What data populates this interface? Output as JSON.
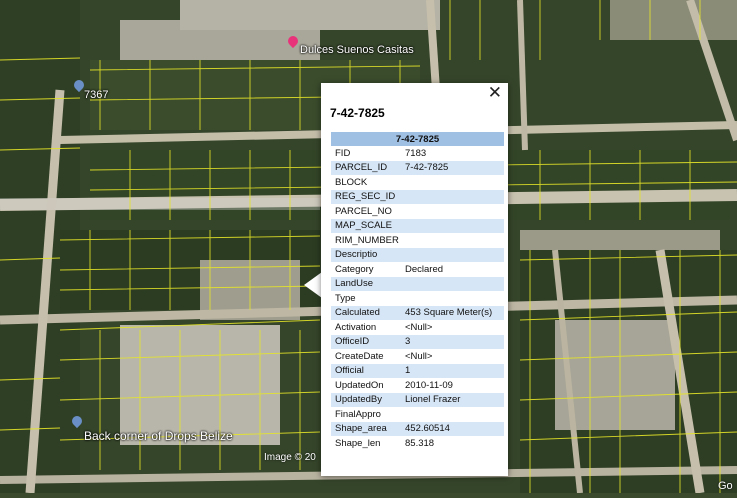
{
  "map": {
    "places": [
      {
        "name": "Dulces Suenos Casitas",
        "pin_color": "#e8337a"
      },
      {
        "name": "7367",
        "pin_color": "#6a8fc7"
      },
      {
        "name": "Back corner of Drops Belize",
        "pin_color": "#6a8fc7"
      }
    ],
    "credit_left": "Image © 20",
    "credit_right": "Go"
  },
  "popup": {
    "title": "7-42-7825",
    "close_glyph": "✕",
    "table_header": "7-42-7825",
    "rows": [
      {
        "key": "FID",
        "value": "7183"
      },
      {
        "key": "PARCEL_ID",
        "value": "7-42-7825"
      },
      {
        "key": "BLOCK",
        "value": ""
      },
      {
        "key": "REG_SEC_ID",
        "value": ""
      },
      {
        "key": "PARCEL_NO",
        "value": ""
      },
      {
        "key": "MAP_SCALE",
        "value": ""
      },
      {
        "key": "RIM_NUMBER",
        "value": ""
      },
      {
        "key": "Descriptio",
        "value": ""
      },
      {
        "key": "Category",
        "value": "Declared"
      },
      {
        "key": "LandUse",
        "value": ""
      },
      {
        "key": "Type",
        "value": ""
      },
      {
        "key": "Calculated",
        "value": "453 Square Meter(s)"
      },
      {
        "key": "Activation",
        "value": "<Null>"
      },
      {
        "key": "OfficeID",
        "value": "3"
      },
      {
        "key": "CreateDate",
        "value": "<Null>"
      },
      {
        "key": "Official",
        "value": "1"
      },
      {
        "key": "UpdatedOn",
        "value": "2010-11-09"
      },
      {
        "key": "UpdatedBy",
        "value": "Lionel Frazer"
      },
      {
        "key": "FinalAppro",
        "value": ""
      },
      {
        "key": "Shape_area",
        "value": "452.60514"
      },
      {
        "key": "Shape_len",
        "value": "85.318"
      }
    ]
  }
}
